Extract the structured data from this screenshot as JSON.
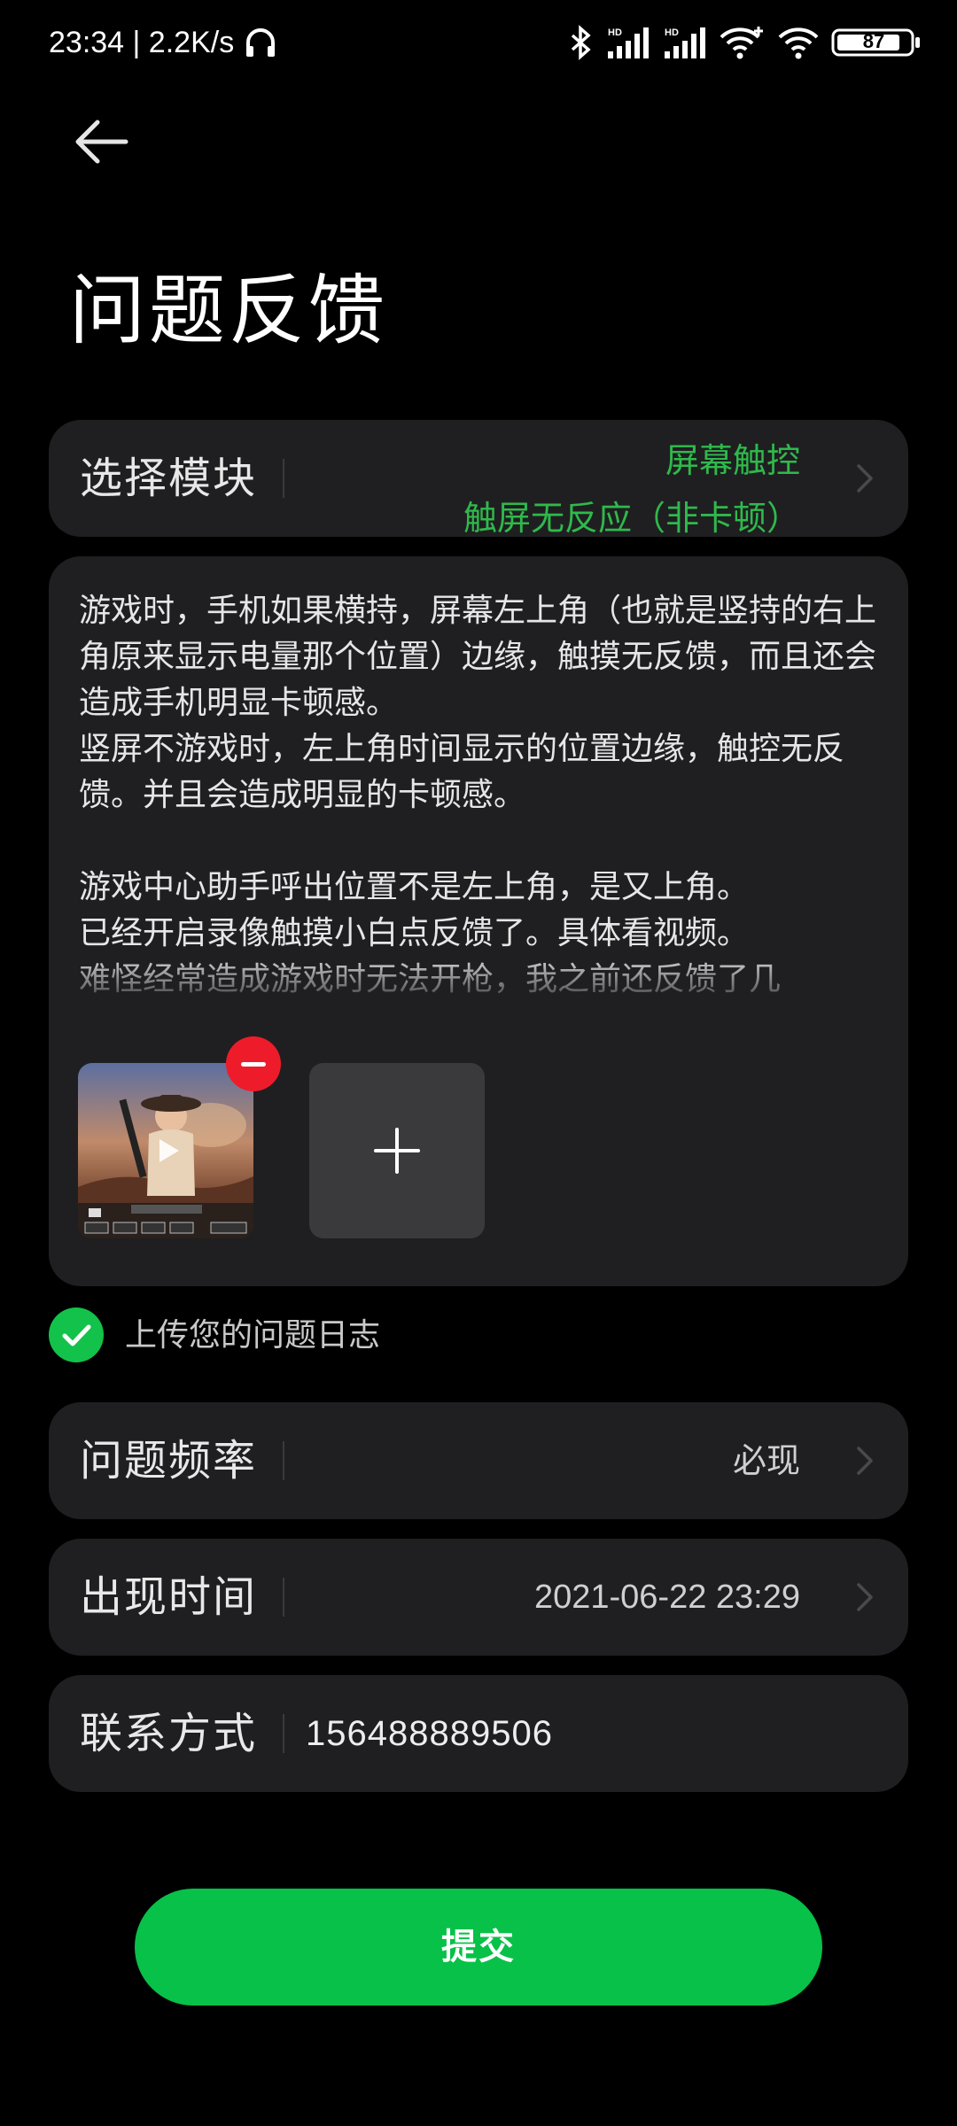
{
  "status_bar": {
    "time_speed": "23:34 | 2.2K/s",
    "battery": "87",
    "icons": [
      "headphones-icon",
      "bluetooth-icon",
      "signal-hd-icon",
      "signal-hd-icon",
      "wifi-plus-icon",
      "wifi-icon",
      "battery-icon"
    ]
  },
  "header": {
    "title": "问题反馈"
  },
  "module_row": {
    "label": "选择模块",
    "value_line1": "屏幕触控",
    "value_line2": "触屏无反应（非卡顿）"
  },
  "description": {
    "text": "游戏时，手机如果横持，屏幕左上角（也就是竖持的右上角原来显示电量那个位置）边缘，触摸无反馈，而且还会造成手机明显卡顿感。\n竖屏不游戏时，左上角时间显示的位置边缘，触控无反馈。并且会造成明显的卡顿感。\n\n游戏中心助手呼出位置不是左上角，是又上角。\n已经开启录像触摸小白点反馈了。具体看视频。\n难怪经常造成游戏时无法开枪，我之前还反馈了几"
  },
  "log_option": {
    "label": "上传您的问题日志",
    "checked": true
  },
  "frequency_row": {
    "label": "问题频率",
    "value": "必现"
  },
  "time_row": {
    "label": "出现时间",
    "value": "2021-06-22 23:29"
  },
  "contact_row": {
    "label": "联系方式",
    "value": "156488889506"
  },
  "submit": {
    "label": "提交"
  },
  "colors": {
    "accent_green": "#08c148",
    "module_text_green": "#2fb94c",
    "card_bg": "#1f1f21",
    "remove_red": "#ee1c2b"
  }
}
